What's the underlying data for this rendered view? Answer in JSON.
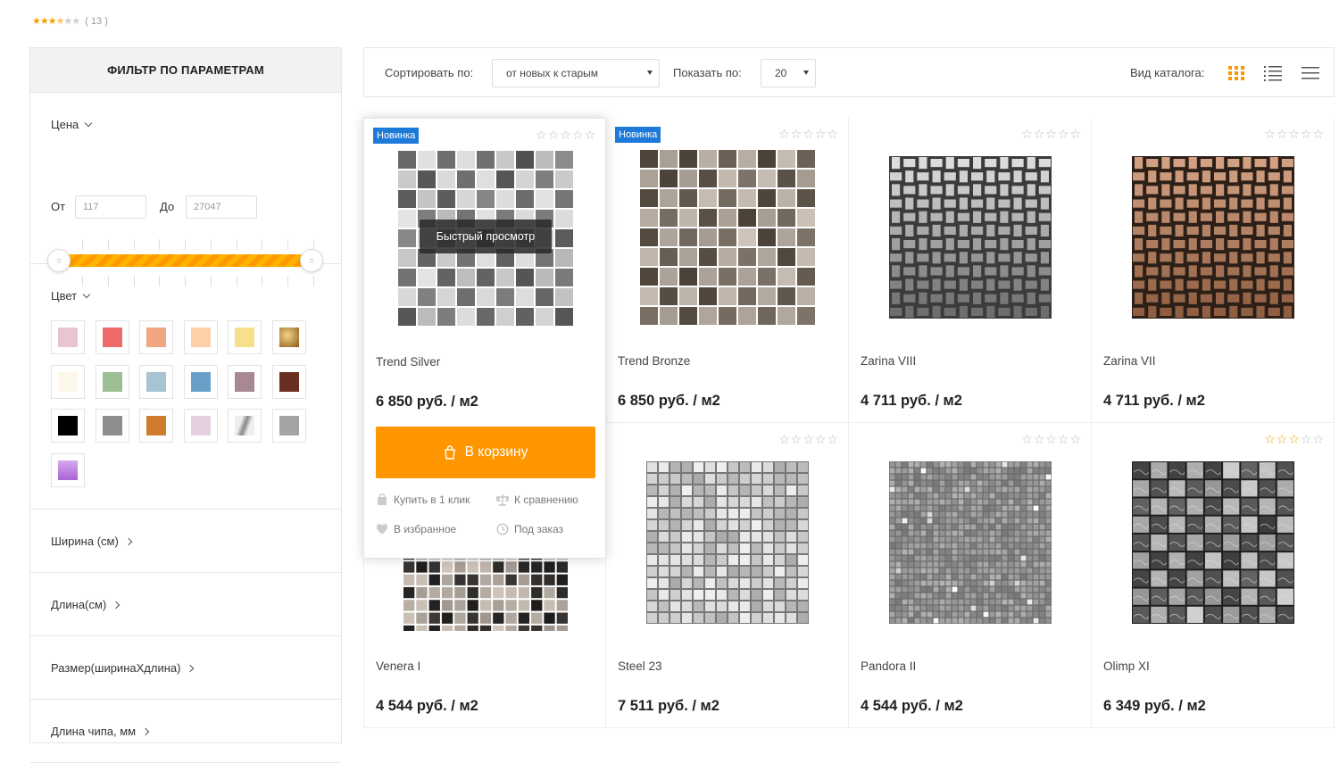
{
  "top_rating": {
    "stars_on": "★★★",
    "stars_half": "★",
    "stars_off": "★",
    "count": "( 13 )"
  },
  "sidebar": {
    "title": "ФИЛЬТР ПО ПАРАМЕТРАМ",
    "price": {
      "title": "Цена",
      "from_label": "От",
      "from_value": "117",
      "to_label": "До",
      "to_value": "27047"
    },
    "color": {
      "title": "Цвет"
    },
    "width": {
      "title": "Ширина (см)"
    },
    "length": {
      "title": "Длина(см)"
    },
    "size": {
      "title": "Размер(ширинаХдлина)"
    },
    "chip": {
      "title": "Длина чипа, мм"
    }
  },
  "toolbar": {
    "sort_label": "Сортировать по:",
    "sort_value": "от новых к старым",
    "show_label": "Показать по:",
    "show_value": "20",
    "view_label": "Вид каталога:"
  },
  "colors": {
    "accent": "#ff9600",
    "badge": "#1e7ad8",
    "swatches": [
      "#e9c5cf",
      "#ef6b6b",
      "#f0a583",
      "#fcd1a7",
      "#f7e08a",
      "#b9822e",
      "#fbf8ea",
      "#9bbf93",
      "#a7c3d4",
      "#6a9fc8",
      "#a98896",
      "#6a2f21",
      "#000000",
      "#8d8d8d",
      "#cf7c2e",
      "#e3d0e0",
      "#c9c9c9",
      "#a4a4a4",
      "#c28ae3"
    ]
  },
  "products": [
    {
      "name": "Trend Silver",
      "price": "6 850 руб. / м2",
      "badge": "Новинка",
      "rating": 0
    },
    {
      "name": "Trend Bronze",
      "price": "6 850 руб. / м2",
      "badge": "Новинка",
      "rating": 0
    },
    {
      "name": "Zarina VIII",
      "price": "4 711 руб. / м2",
      "badge": "",
      "rating": 0
    },
    {
      "name": "Zarina VII",
      "price": "4 711 руб. / м2",
      "badge": "",
      "rating": 0
    },
    {
      "name": "Venera I",
      "price": "4 544 руб. / м2",
      "badge": "",
      "rating": 0
    },
    {
      "name": "Steel 23",
      "price": "7 511 руб. / м2",
      "badge": "",
      "rating": 0
    },
    {
      "name": "Pandora II",
      "price": "4 544 руб. / м2",
      "badge": "",
      "rating": 0
    },
    {
      "name": "Olimp XI",
      "price": "6 349 руб. / м2",
      "badge": "",
      "rating": 3
    }
  ],
  "active_card": {
    "quick_view": "Быстрый просмотр",
    "cart_label": "В корзину",
    "buy_one_click": "Купить в 1 клик",
    "compare": "К сравнению",
    "favorite": "В избранное",
    "on_order": "Под заказ"
  }
}
